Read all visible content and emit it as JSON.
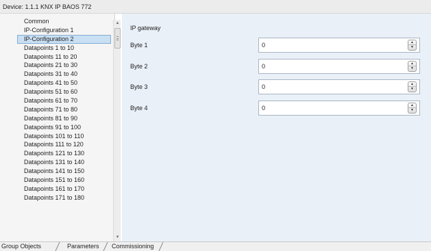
{
  "title_bar": {
    "device_label": "Device: 1.1.1  KNX IP BAOS 772"
  },
  "sidebar": {
    "items": [
      {
        "label": "Common",
        "selected": false
      },
      {
        "label": "IP-Configuration 1",
        "selected": false
      },
      {
        "label": "IP-Configuration 2",
        "selected": true
      },
      {
        "label": "Datapoints 1 to 10",
        "selected": false
      },
      {
        "label": "Datapoints 11 to 20",
        "selected": false
      },
      {
        "label": "Datapoints 21 to 30",
        "selected": false
      },
      {
        "label": "Datapoints 31 to 40",
        "selected": false
      },
      {
        "label": "Datapoints 41 to 50",
        "selected": false
      },
      {
        "label": "Datapoints 51 to 60",
        "selected": false
      },
      {
        "label": "Datapoints 61 to 70",
        "selected": false
      },
      {
        "label": "Datapoints 71 to 80",
        "selected": false
      },
      {
        "label": "Datapoints 81 to 90",
        "selected": false
      },
      {
        "label": "Datapoints 91 to 100",
        "selected": false
      },
      {
        "label": "Datapoints 101 to 110",
        "selected": false
      },
      {
        "label": "Datapoints 111 to 120",
        "selected": false
      },
      {
        "label": "Datapoints 121 to 130",
        "selected": false
      },
      {
        "label": "Datapoints 131 to 140",
        "selected": false
      },
      {
        "label": "Datapoints 141 to 150",
        "selected": false
      },
      {
        "label": "Datapoints 151 to 160",
        "selected": false
      },
      {
        "label": "Datapoints 161 to 170",
        "selected": false
      },
      {
        "label": "Datapoints 171 to 180",
        "selected": false
      }
    ]
  },
  "main": {
    "section_title": "IP gateway",
    "params": [
      {
        "label": "Byte 1",
        "value": "0"
      },
      {
        "label": "Byte 2",
        "value": "0"
      },
      {
        "label": "Byte 3",
        "value": "0"
      },
      {
        "label": "Byte 4",
        "value": "0"
      }
    ]
  },
  "tabs": [
    {
      "label": "Group Objects",
      "active": false
    },
    {
      "label": "Parameters",
      "active": true
    },
    {
      "label": "Commissioning",
      "active": false
    }
  ],
  "colors": {
    "selection_background": "#c9dff3",
    "panel_background": "#e9f0f7",
    "sidebar_background": "#f5f5f5"
  }
}
